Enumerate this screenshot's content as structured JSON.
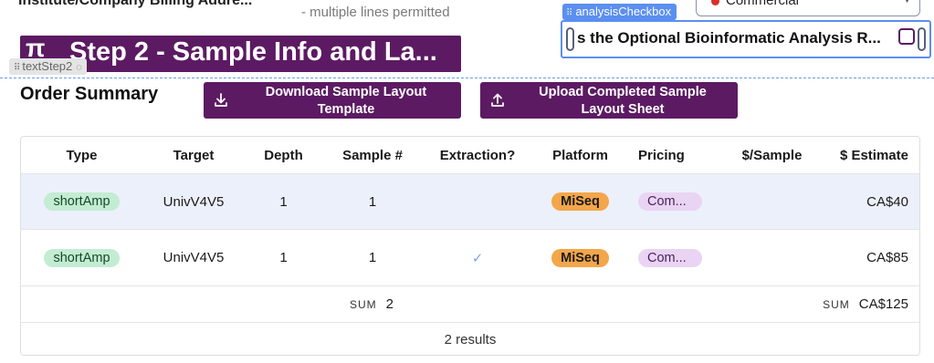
{
  "form_fragment": {
    "billing_label": "Institute/Company Billing Addre...",
    "hint": "- multiple lines permitted",
    "organization_select": {
      "value": "Commercial",
      "dot_color": "#d93025"
    }
  },
  "analysis_checkbox": {
    "tag": "analysisCheckbox",
    "label": "s the Optional Bioinformatic Analysis R..."
  },
  "step": {
    "title": "Step 2 - Sample Info and La...",
    "tag": "textStep2"
  },
  "order_summary": {
    "title": "Order Summary",
    "download_button": "Download Sample Layout Template",
    "upload_button": "Upload Completed Sample Layout Sheet"
  },
  "table": {
    "headers": {
      "type": "Type",
      "target": "Target",
      "depth": "Depth",
      "sample": "Sample #",
      "extraction": "Extraction?",
      "platform": "Platform",
      "pricing": "Pricing",
      "per_sample": "$/Sample",
      "estimate": "$ Estimate"
    },
    "rows": [
      {
        "type": "shortAmp",
        "target": "UnivV4V5",
        "depth": "1",
        "sample": "1",
        "extraction": "",
        "platform": "MiSeq",
        "pricing": "Com...",
        "per_sample": "",
        "estimate": "CA$40"
      },
      {
        "type": "shortAmp",
        "target": "UnivV4V5",
        "depth": "1",
        "sample": "1",
        "extraction": "✓",
        "platform": "MiSeq",
        "pricing": "Com...",
        "per_sample": "",
        "estimate": "CA$85"
      }
    ],
    "sum": {
      "label": "SUM",
      "samples": "2",
      "estimate": "CA$125"
    },
    "footer": "2 results"
  },
  "colors": {
    "brand": "#5c1a63",
    "selection": "#5b8ff0",
    "row_highlight": "#ecf0fb"
  }
}
